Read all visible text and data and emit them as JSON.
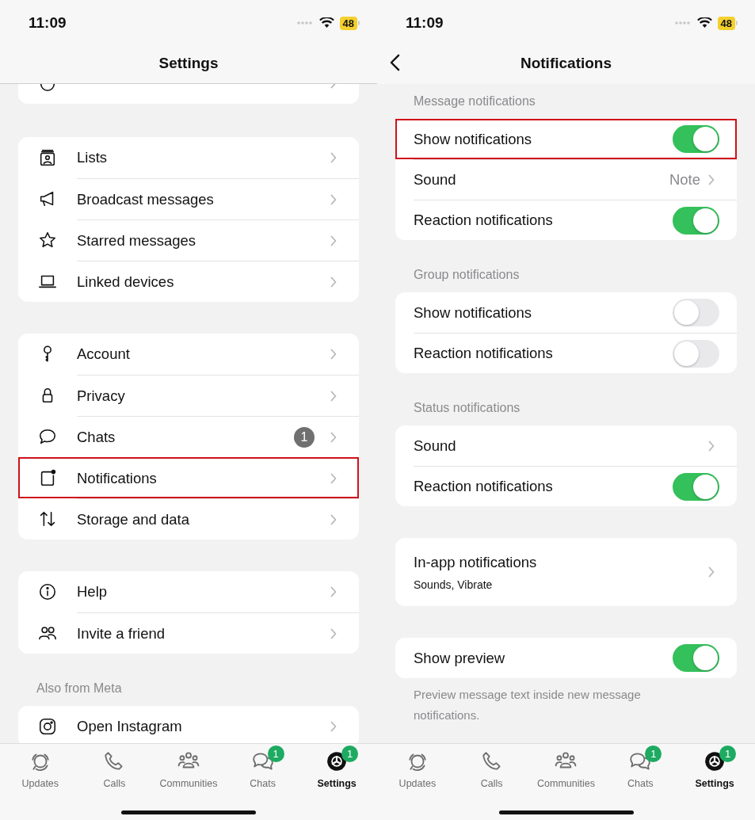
{
  "screens": [
    {
      "status_bar": {
        "time": "11:09",
        "battery": "48"
      },
      "nav": {
        "title": "Settings",
        "back": false
      },
      "scrolled": true,
      "sections": [
        {
          "rows": [
            {
              "kind": "link"
            }
          ]
        },
        {
          "rows": [
            {
              "kind": "link",
              "label": "Lists",
              "highlighted": false
            },
            {
              "kind": "link",
              "label": "Broadcast messages",
              "highlighted": false
            },
            {
              "kind": "link",
              "label": "Starred messages",
              "highlighted": false
            },
            {
              "kind": "link",
              "label": "Linked devices",
              "highlighted": false
            }
          ]
        },
        {
          "rows": [
            {
              "kind": "link",
              "label": "Account",
              "highlighted": false
            },
            {
              "kind": "link",
              "label": "Privacy",
              "highlighted": false
            },
            {
              "kind": "link",
              "label": "Chats",
              "badge": "1",
              "highlighted": false
            },
            {
              "kind": "link",
              "label": "Notifications",
              "highlighted": true
            },
            {
              "kind": "link",
              "label": "Storage and data",
              "highlighted": false
            }
          ]
        },
        {
          "rows": [
            {
              "kind": "link",
              "label": "Help",
              "highlighted": false
            },
            {
              "kind": "link",
              "label": "Invite a friend",
              "highlighted": false
            }
          ]
        },
        {
          "header": "Also from Meta",
          "rows": [
            {
              "kind": "link",
              "label": "Open Instagram",
              "highlighted": false
            }
          ]
        }
      ],
      "tab_bar": [
        {
          "label": "Updates",
          "selected": false
        },
        {
          "label": "Calls",
          "selected": false
        },
        {
          "label": "Communities",
          "selected": false
        },
        {
          "label": "Chats",
          "selected": false,
          "badge": "1"
        },
        {
          "label": "Settings",
          "selected": true,
          "badge": "1"
        }
      ]
    },
    {
      "status_bar": {
        "time": "11:09",
        "battery": "48"
      },
      "nav": {
        "title": "Notifications",
        "back": true
      },
      "scrolled": false,
      "sections": [
        {
          "header": "Message notifications",
          "rows": [
            {
              "kind": "toggle",
              "label": "Show notifications",
              "on": true,
              "highlighted": true
            },
            {
              "kind": "value",
              "label": "Sound",
              "value": "Note",
              "highlighted": false
            },
            {
              "kind": "toggle",
              "label": "Reaction notifications",
              "on": true,
              "highlighted": false
            }
          ]
        },
        {
          "header": "Group notifications",
          "rows": [
            {
              "kind": "toggle",
              "label": "Show notifications",
              "on": false,
              "highlighted": false
            },
            {
              "kind": "toggle",
              "label": "Reaction notifications",
              "on": false,
              "highlighted": false
            }
          ]
        },
        {
          "header": "Status notifications",
          "rows": [
            {
              "kind": "link",
              "label": "Sound",
              "highlighted": false
            },
            {
              "kind": "toggle",
              "label": "Reaction notifications",
              "on": true,
              "highlighted": false
            }
          ]
        },
        {
          "rows": [
            {
              "kind": "subtitle",
              "label": "In-app notifications",
              "subtitle": "Sounds, Vibrate",
              "highlighted": false
            }
          ]
        },
        {
          "rows": [
            {
              "kind": "toggle",
              "label": "Show preview",
              "on": true,
              "highlighted": false
            }
          ],
          "footer": "Preview message text inside new message notifications."
        }
      ],
      "tab_bar": [
        {
          "label": "Updates",
          "selected": false
        },
        {
          "label": "Calls",
          "selected": false
        },
        {
          "label": "Communities",
          "selected": false
        },
        {
          "label": "Chats",
          "selected": false,
          "badge": "1"
        },
        {
          "label": "Settings",
          "selected": true,
          "badge": "1"
        }
      ]
    }
  ]
}
